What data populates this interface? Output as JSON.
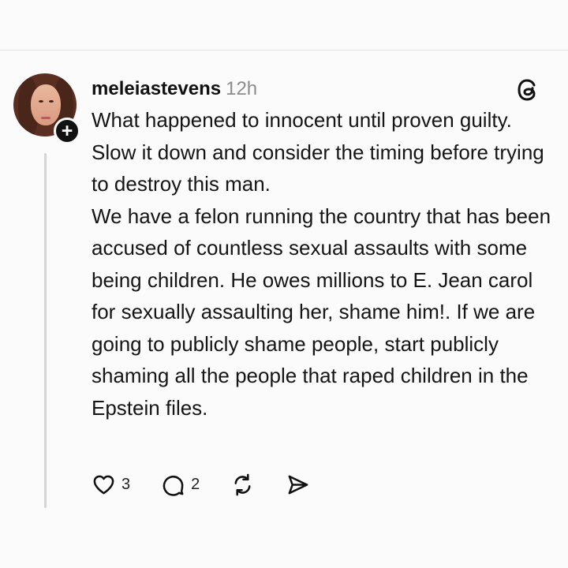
{
  "post": {
    "username": "meleiastevens",
    "time": "12h",
    "paragraphs": [
      "What happened to innocent until proven guilty. Slow it down and consider the timing before trying to destroy this man.",
      "We have a felon running the country that has been accused of countless sexual assaults with some being children.  He owes millions to E. Jean carol for sexually assaulting her, shame him!. If we are going to publicly shame people, start publicly shaming all the people that raped children in the Epstein files."
    ],
    "follow_symbol": "+",
    "platform_icon": "threads-icon"
  },
  "actions": {
    "like_count": "3",
    "reply_count": "2",
    "like_icon": "heart-icon",
    "reply_icon": "comment-icon",
    "repost_icon": "repost-icon",
    "share_icon": "send-icon"
  }
}
